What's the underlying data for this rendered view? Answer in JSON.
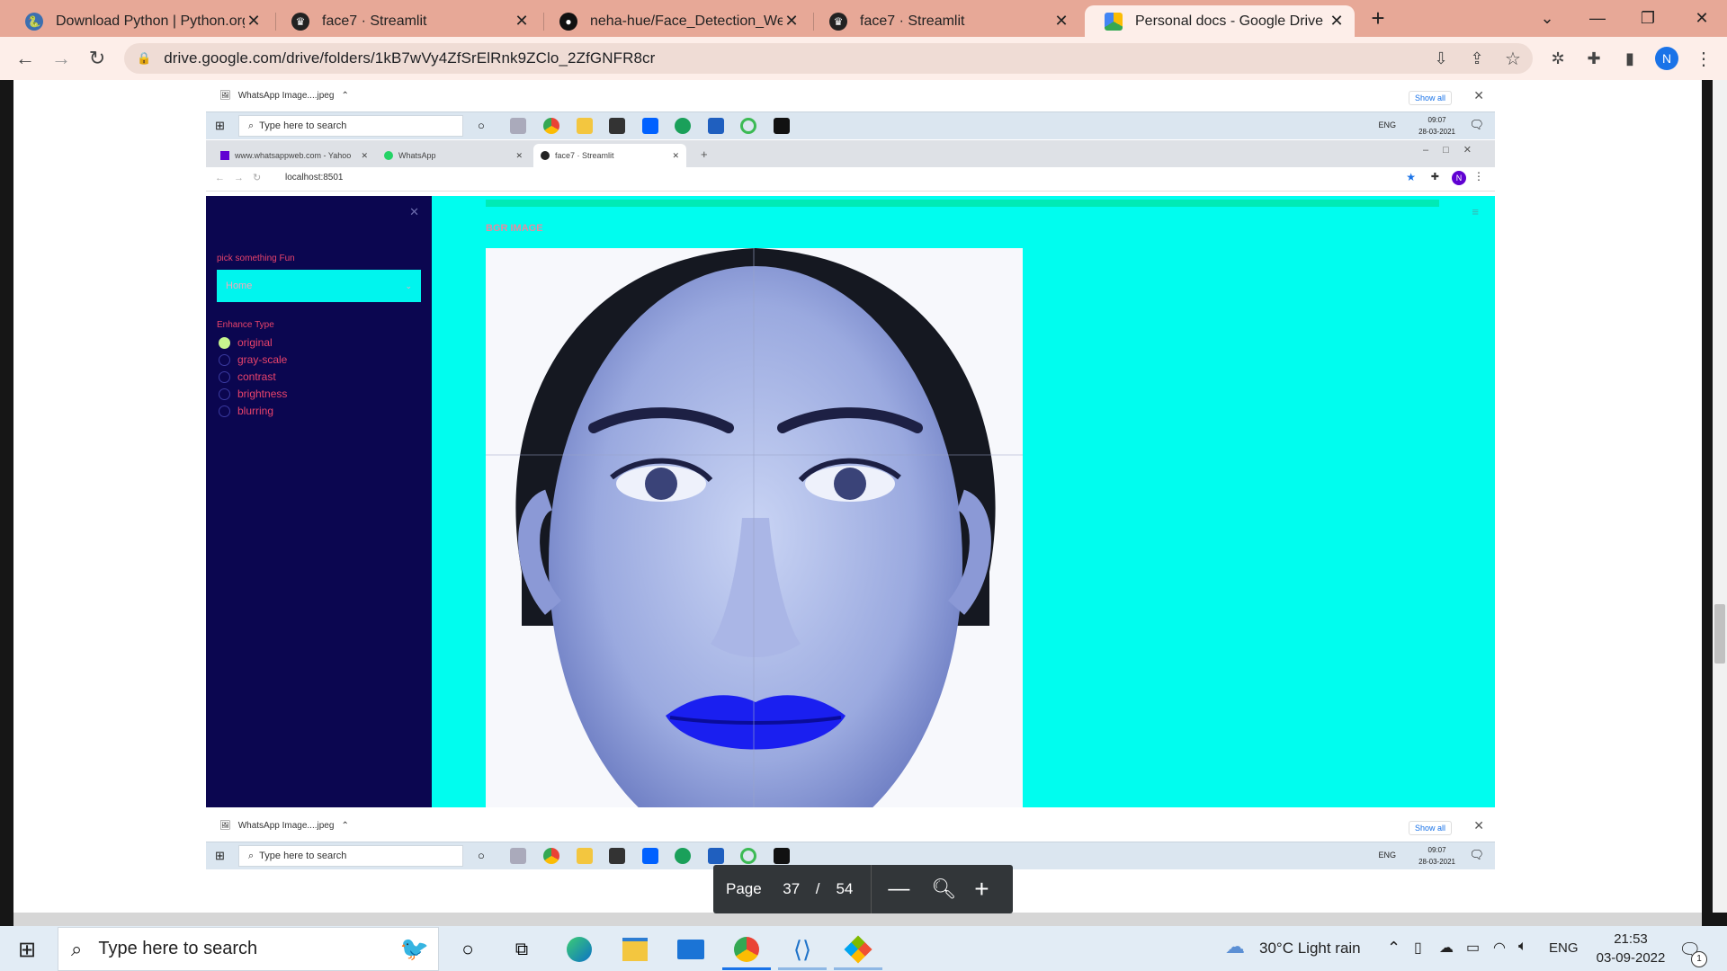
{
  "browser": {
    "tabs": [
      {
        "title": "Download Python | Python.org",
        "icon": "python-icon"
      },
      {
        "title": "face7 · Streamlit",
        "icon": "streamlit-icon"
      },
      {
        "title": "neha-hue/Face_Detection_WebA",
        "icon": "github-icon"
      },
      {
        "title": "face7 · Streamlit",
        "icon": "streamlit-icon"
      },
      {
        "title": "Personal docs - Google Drive",
        "icon": "google-drive-icon",
        "active": true
      }
    ],
    "url": "drive.google.com/drive/folders/1kB7wVy4ZfSrElRnk9ZClo_2ZfGNFR8cr",
    "profile_initial": "N",
    "accent": "#1a73e8"
  },
  "screenshot": {
    "top_download_item": "WhatsApp Image....jpeg",
    "show_all": "Show all",
    "taskbar_search": "Type here to search",
    "taskbar_lang": "ENG",
    "taskbar_time": "09:07",
    "taskbar_date": "28-03-2021",
    "inner_tabs": [
      {
        "title": "www.whatsappweb.com - Yahoo",
        "icon": "yahoo-icon"
      },
      {
        "title": "WhatsApp",
        "icon": "whatsapp-icon"
      },
      {
        "title": "face7 · Streamlit",
        "icon": "streamlit-icon",
        "active": true
      }
    ],
    "inner_url": "localhost:8501",
    "app": {
      "sidebar_pick_label": "pick something Fun",
      "select_value": "Home",
      "enhance_label": "Enhance Type",
      "radio_options": [
        "original",
        "gray-scale",
        "contrast",
        "brightness",
        "blurring"
      ],
      "radio_selected": "original",
      "main_caption": "BGR IMAGE",
      "sidebar_color": "#0b0650",
      "main_color": "#00fdef",
      "label_color": "#e8436b"
    },
    "bottom_download_item": "WhatsApp Image....jpeg"
  },
  "pdf_controls": {
    "page_label": "Page",
    "current_page": "37",
    "separator": "/",
    "total_pages": "54"
  },
  "windows_taskbar": {
    "search_placeholder": "Type here to search",
    "weather": "30°C  Light rain",
    "lang": "ENG",
    "time": "21:53",
    "date": "03-09-2022",
    "notification_count": "1"
  }
}
